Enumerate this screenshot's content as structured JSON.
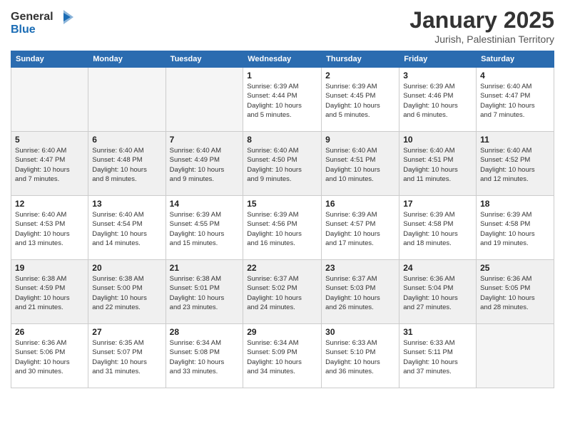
{
  "logo": {
    "line1": "General",
    "line2": "Blue"
  },
  "title": "January 2025",
  "location": "Jurish, Palestinian Territory",
  "weekdays": [
    "Sunday",
    "Monday",
    "Tuesday",
    "Wednesday",
    "Thursday",
    "Friday",
    "Saturday"
  ],
  "rows": [
    [
      {
        "num": "",
        "info": ""
      },
      {
        "num": "",
        "info": ""
      },
      {
        "num": "",
        "info": ""
      },
      {
        "num": "1",
        "info": "Sunrise: 6:39 AM\nSunset: 4:44 PM\nDaylight: 10 hours\nand 5 minutes."
      },
      {
        "num": "2",
        "info": "Sunrise: 6:39 AM\nSunset: 4:45 PM\nDaylight: 10 hours\nand 5 minutes."
      },
      {
        "num": "3",
        "info": "Sunrise: 6:39 AM\nSunset: 4:46 PM\nDaylight: 10 hours\nand 6 minutes."
      },
      {
        "num": "4",
        "info": "Sunrise: 6:40 AM\nSunset: 4:47 PM\nDaylight: 10 hours\nand 7 minutes."
      }
    ],
    [
      {
        "num": "5",
        "info": "Sunrise: 6:40 AM\nSunset: 4:47 PM\nDaylight: 10 hours\nand 7 minutes."
      },
      {
        "num": "6",
        "info": "Sunrise: 6:40 AM\nSunset: 4:48 PM\nDaylight: 10 hours\nand 8 minutes."
      },
      {
        "num": "7",
        "info": "Sunrise: 6:40 AM\nSunset: 4:49 PM\nDaylight: 10 hours\nand 9 minutes."
      },
      {
        "num": "8",
        "info": "Sunrise: 6:40 AM\nSunset: 4:50 PM\nDaylight: 10 hours\nand 9 minutes."
      },
      {
        "num": "9",
        "info": "Sunrise: 6:40 AM\nSunset: 4:51 PM\nDaylight: 10 hours\nand 10 minutes."
      },
      {
        "num": "10",
        "info": "Sunrise: 6:40 AM\nSunset: 4:51 PM\nDaylight: 10 hours\nand 11 minutes."
      },
      {
        "num": "11",
        "info": "Sunrise: 6:40 AM\nSunset: 4:52 PM\nDaylight: 10 hours\nand 12 minutes."
      }
    ],
    [
      {
        "num": "12",
        "info": "Sunrise: 6:40 AM\nSunset: 4:53 PM\nDaylight: 10 hours\nand 13 minutes."
      },
      {
        "num": "13",
        "info": "Sunrise: 6:40 AM\nSunset: 4:54 PM\nDaylight: 10 hours\nand 14 minutes."
      },
      {
        "num": "14",
        "info": "Sunrise: 6:39 AM\nSunset: 4:55 PM\nDaylight: 10 hours\nand 15 minutes."
      },
      {
        "num": "15",
        "info": "Sunrise: 6:39 AM\nSunset: 4:56 PM\nDaylight: 10 hours\nand 16 minutes."
      },
      {
        "num": "16",
        "info": "Sunrise: 6:39 AM\nSunset: 4:57 PM\nDaylight: 10 hours\nand 17 minutes."
      },
      {
        "num": "17",
        "info": "Sunrise: 6:39 AM\nSunset: 4:58 PM\nDaylight: 10 hours\nand 18 minutes."
      },
      {
        "num": "18",
        "info": "Sunrise: 6:39 AM\nSunset: 4:58 PM\nDaylight: 10 hours\nand 19 minutes."
      }
    ],
    [
      {
        "num": "19",
        "info": "Sunrise: 6:38 AM\nSunset: 4:59 PM\nDaylight: 10 hours\nand 21 minutes."
      },
      {
        "num": "20",
        "info": "Sunrise: 6:38 AM\nSunset: 5:00 PM\nDaylight: 10 hours\nand 22 minutes."
      },
      {
        "num": "21",
        "info": "Sunrise: 6:38 AM\nSunset: 5:01 PM\nDaylight: 10 hours\nand 23 minutes."
      },
      {
        "num": "22",
        "info": "Sunrise: 6:37 AM\nSunset: 5:02 PM\nDaylight: 10 hours\nand 24 minutes."
      },
      {
        "num": "23",
        "info": "Sunrise: 6:37 AM\nSunset: 5:03 PM\nDaylight: 10 hours\nand 26 minutes."
      },
      {
        "num": "24",
        "info": "Sunrise: 6:36 AM\nSunset: 5:04 PM\nDaylight: 10 hours\nand 27 minutes."
      },
      {
        "num": "25",
        "info": "Sunrise: 6:36 AM\nSunset: 5:05 PM\nDaylight: 10 hours\nand 28 minutes."
      }
    ],
    [
      {
        "num": "26",
        "info": "Sunrise: 6:36 AM\nSunset: 5:06 PM\nDaylight: 10 hours\nand 30 minutes."
      },
      {
        "num": "27",
        "info": "Sunrise: 6:35 AM\nSunset: 5:07 PM\nDaylight: 10 hours\nand 31 minutes."
      },
      {
        "num": "28",
        "info": "Sunrise: 6:34 AM\nSunset: 5:08 PM\nDaylight: 10 hours\nand 33 minutes."
      },
      {
        "num": "29",
        "info": "Sunrise: 6:34 AM\nSunset: 5:09 PM\nDaylight: 10 hours\nand 34 minutes."
      },
      {
        "num": "30",
        "info": "Sunrise: 6:33 AM\nSunset: 5:10 PM\nDaylight: 10 hours\nand 36 minutes."
      },
      {
        "num": "31",
        "info": "Sunrise: 6:33 AM\nSunset: 5:11 PM\nDaylight: 10 hours\nand 37 minutes."
      },
      {
        "num": "",
        "info": ""
      }
    ]
  ]
}
